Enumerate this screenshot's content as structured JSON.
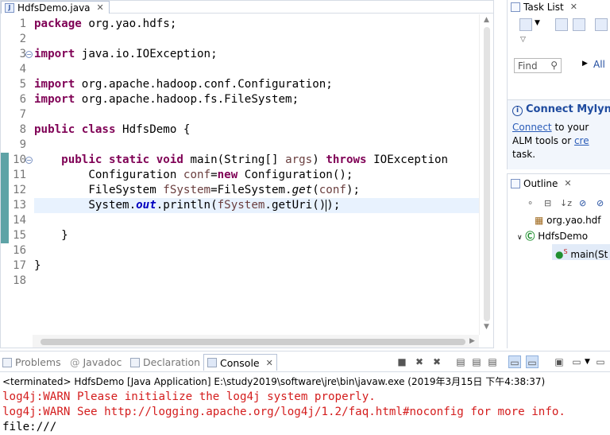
{
  "editor": {
    "tab_label": "HdfsDemo.java",
    "tab_icon": "java-file-icon",
    "line_numbers": [
      "1",
      "2",
      "3",
      "4",
      "5",
      "6",
      "7",
      "8",
      "9",
      "10",
      "11",
      "12",
      "13",
      "14",
      "15",
      "16",
      "17",
      "18"
    ],
    "lines": [
      [
        {
          "t": "package",
          "c": "kw"
        },
        {
          "t": " org.yao.hdfs;"
        }
      ],
      [],
      [
        {
          "t": "import",
          "c": "kw"
        },
        {
          "t": " java.io.IOException;"
        }
      ],
      [],
      [
        {
          "t": "import",
          "c": "kw"
        },
        {
          "t": " org.apache.hadoop.conf.Configuration;"
        }
      ],
      [
        {
          "t": "import",
          "c": "kw"
        },
        {
          "t": " org.apache.hadoop.fs.FileSystem;"
        }
      ],
      [],
      [
        {
          "t": "public",
          "c": "kw"
        },
        {
          "t": " "
        },
        {
          "t": "class",
          "c": "kw"
        },
        {
          "t": " HdfsDemo {"
        }
      ],
      [],
      [
        {
          "t": "    "
        },
        {
          "t": "public",
          "c": "kw"
        },
        {
          "t": " "
        },
        {
          "t": "static",
          "c": "kw"
        },
        {
          "t": " "
        },
        {
          "t": "void",
          "c": "kw"
        },
        {
          "t": " main(String[] "
        },
        {
          "t": "args",
          "c": "var"
        },
        {
          "t": ") "
        },
        {
          "t": "throws",
          "c": "kw"
        },
        {
          "t": " IOException "
        }
      ],
      [
        {
          "t": "        Configuration "
        },
        {
          "t": "conf",
          "c": "var"
        },
        {
          "t": "="
        },
        {
          "t": "new",
          "c": "kw"
        },
        {
          "t": " Configuration();"
        }
      ],
      [
        {
          "t": "        FileSystem "
        },
        {
          "t": "fSystem",
          "c": "var"
        },
        {
          "t": "=FileSystem."
        },
        {
          "t": "get",
          "c": "mth"
        },
        {
          "t": "("
        },
        {
          "t": "conf",
          "c": "var"
        },
        {
          "t": ");"
        }
      ],
      [
        {
          "t": "        System."
        },
        {
          "t": "out",
          "c": "fld"
        },
        {
          "t": ".println("
        },
        {
          "t": "fSystem",
          "c": "var"
        },
        {
          "t": ".getUri()"
        },
        {
          "t": "|",
          "c": "caret"
        },
        {
          "t": ");"
        }
      ],
      [],
      [
        {
          "t": "    }"
        }
      ],
      [],
      [
        {
          "t": "}"
        }
      ],
      []
    ]
  },
  "task_list": {
    "title": "Task List",
    "find_placeholder": "Find",
    "all_label": "All"
  },
  "mylyn": {
    "title": "Connect Mylyn",
    "link_text": "Connect",
    "body1": " to your",
    "body2": "ALM tools or ",
    "link2": "cre",
    "body3": "task."
  },
  "outline": {
    "title": "Outline",
    "package": "org.yao.hdf",
    "class": "HdfsDemo",
    "method": "main(St"
  },
  "console": {
    "tabs": [
      "Problems",
      "Javadoc",
      "Declaration",
      "Console"
    ],
    "active_tab": "Console",
    "status": "<terminated> HdfsDemo [Java Application] E:\\study2019\\software\\jre\\bin\\javaw.exe (2019年3月15日 下午4:38:37)",
    "output": [
      {
        "text": "log4j:WARN Please initialize the log4j system properly.",
        "kind": "err"
      },
      {
        "text": "log4j:WARN See http://logging.apache.org/log4j/1.2/faq.html#noconfig for more info.",
        "kind": "err"
      },
      {
        "text": "file:///",
        "kind": "out"
      }
    ]
  },
  "colors": {
    "keyword": "#7f0055",
    "field": "#0000c0",
    "variable": "#6a3e3e",
    "error_text": "#d41d1d",
    "current_line": "#e8f2fe",
    "change_bar": "#5ea3a6"
  }
}
